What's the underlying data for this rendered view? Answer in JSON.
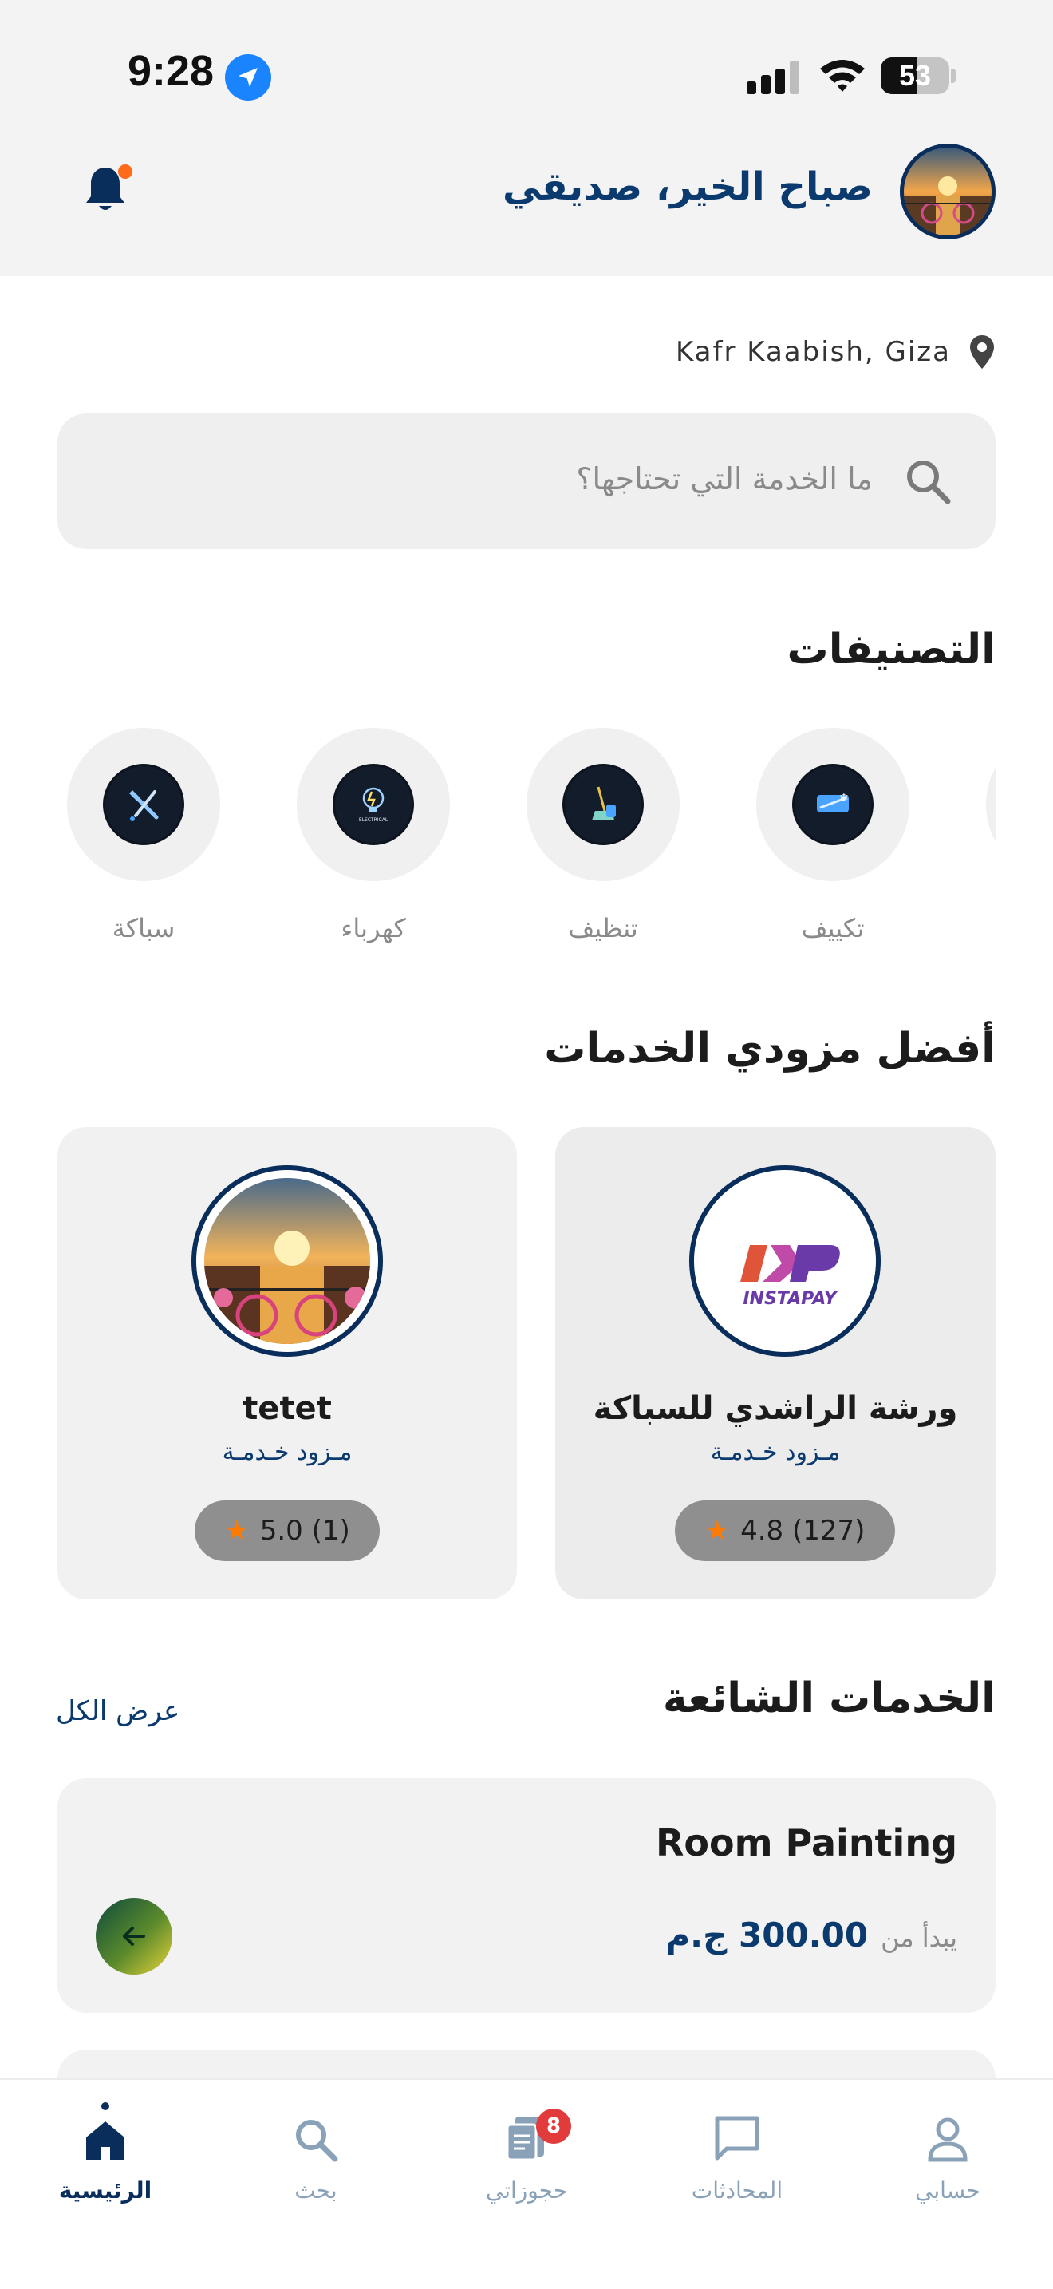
{
  "status_bar": {
    "time": "9:28",
    "battery": "53",
    "battery_level": 0.53,
    "icons": [
      "location-arrow-icon",
      "signal-icon",
      "wifi-icon",
      "battery-icon"
    ]
  },
  "header": {
    "greeting": "صباح الخير، صديقي",
    "notification_icon": "bell-icon",
    "has_notification_dot": true
  },
  "location": {
    "text": "Kafr Kaabish, Giza",
    "icon": "map-pin-icon"
  },
  "search": {
    "placeholder": "ما الخدمة التي تحتاجها؟",
    "icon": "search-icon"
  },
  "categories": {
    "title": "التصنيفات",
    "items": [
      {
        "label": "تكييف",
        "icon": "air-conditioning-icon"
      },
      {
        "label": "تنظيف",
        "icon": "cleaning-icon"
      },
      {
        "label": "كهرباء",
        "icon": "electrical-bulb-icon",
        "icon_text": "ELECTRICAL"
      },
      {
        "label": "سباكة",
        "icon": "plumbing-tools-icon"
      }
    ]
  },
  "providers": {
    "title": "أفضل مزودي الخدمات",
    "items": [
      {
        "name": "ورشة الراشدي للسباكة",
        "role": "مـزود خـدمـة",
        "rating": "4.8 (127)",
        "logo_text": "INSTAPAY"
      },
      {
        "name": "tetet",
        "role": "مـزود خـدمـة",
        "rating": "5.0 (1)"
      }
    ]
  },
  "popular": {
    "title": "الخدمات الشائعة",
    "see_all": "عرض الكل",
    "items": [
      {
        "title": "Room Painting",
        "from_label": "يبدأ من",
        "price": "300.00 ج.م"
      }
    ]
  },
  "tabbar": {
    "items": [
      {
        "label": "حسابي",
        "icon": "profile-icon"
      },
      {
        "label": "المحادثات",
        "icon": "chat-icon"
      },
      {
        "label": "حجوزاتي",
        "icon": "bookings-icon",
        "badge": "8"
      },
      {
        "label": "بحث",
        "icon": "search-icon"
      },
      {
        "label": "الرئيسية",
        "icon": "home-icon",
        "active": true
      }
    ]
  },
  "colors": {
    "primary": "#0a3a6e",
    "accent": "#ff7a00",
    "badge": "#e23b3b",
    "status_location": "#1a84ff"
  }
}
